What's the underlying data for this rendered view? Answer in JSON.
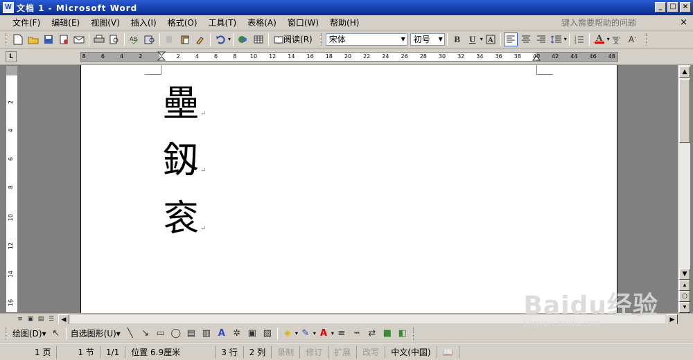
{
  "window": {
    "title": "文档 1 - Microsoft Word",
    "app_icon": "W",
    "min": "_",
    "max": "□",
    "close": "×"
  },
  "menu": {
    "items": [
      "文件(F)",
      "编辑(E)",
      "视图(V)",
      "插入(I)",
      "格式(O)",
      "工具(T)",
      "表格(A)",
      "窗口(W)",
      "帮助(H)"
    ],
    "help_placeholder": "键入需要帮助的问题",
    "help_close": "×"
  },
  "toolbar": {
    "read_label": "阅读(R)",
    "font": "宋体",
    "size": "初号",
    "bold": "B",
    "underline": "U",
    "font_color_glyph": "A"
  },
  "ruler": {
    "box": "L",
    "ticks": [
      "8",
      "6",
      "4",
      "2",
      "2",
      "4",
      "6",
      "8",
      "10",
      "12",
      "14",
      "16",
      "18",
      "20",
      "22",
      "24",
      "26",
      "28",
      "30",
      "32",
      "34",
      "36",
      "38",
      "40",
      "42",
      "44",
      "46",
      "48"
    ],
    "vticks": [
      "2",
      "4",
      "6",
      "8",
      "10",
      "12",
      "14",
      "16"
    ]
  },
  "document": {
    "chars": [
      "壘",
      "釼",
      "衮"
    ],
    "para_mark": "↵"
  },
  "drawbar": {
    "draw_label": "绘图(D)",
    "autoshape_label": "自选图形(U)"
  },
  "status": {
    "page": "1 页",
    "section": "1 节",
    "pages": "1/1",
    "position": "位置 6.9厘米",
    "line": "3 行",
    "col": "2 列",
    "rec": "录制",
    "rev": "修订",
    "ext": "扩展",
    "ovr": "改写",
    "lang": "中文(中国)"
  },
  "watermark": {
    "brand": "Baidu经验",
    "url": "jingyan.baidu.com"
  }
}
